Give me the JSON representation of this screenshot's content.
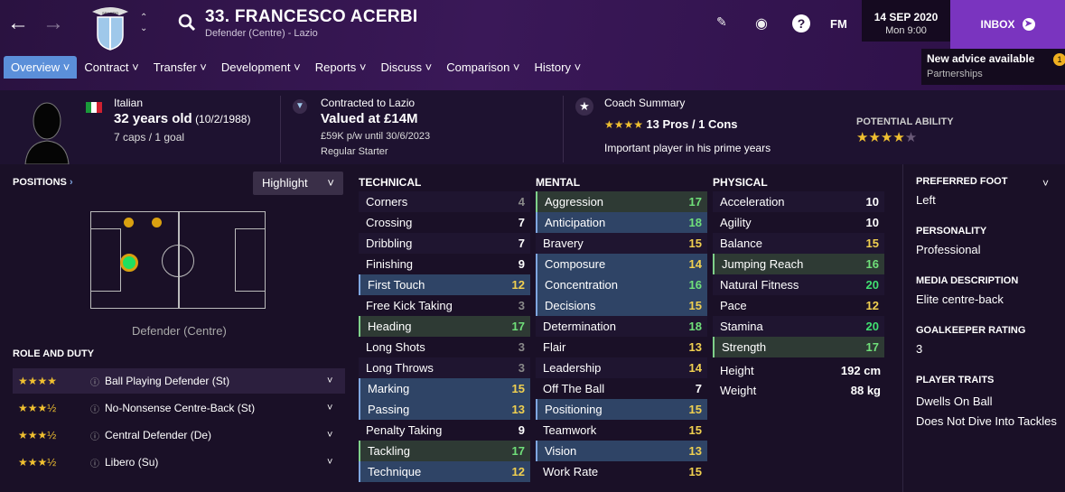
{
  "header": {
    "title": "33. FRANCESCO ACERBI",
    "subtitle": "Defender (Centre) - Lazio",
    "fm_label": "FM",
    "date": "14 SEP 2020",
    "time": "Mon 9:00",
    "inbox_label": "INBOX",
    "advice_title": "New advice available",
    "advice_sub": "Partnerships",
    "advice_count": "1",
    "crest_text": "SS LAZIO"
  },
  "menu": [
    "Overview",
    "Contract",
    "Transfer",
    "Development",
    "Reports",
    "Discuss",
    "Comparison",
    "History"
  ],
  "summary": {
    "nationality": "Italian",
    "age": "32 years old",
    "dob": "(10/2/1988)",
    "caps": "7 caps / 1 goal",
    "contract_label": "Contracted to Lazio",
    "value": "Valued at £14M",
    "wage": "£59K p/w until 30/6/2023",
    "status": "Regular Starter",
    "coach_label": "Coach Summary",
    "coach_summary": "13 Pros / 1 Cons",
    "coach_note": "Important player in his prime years",
    "coach_stars": "★★★★",
    "potential_label": "POTENTIAL ABILITY",
    "potential_stars": "★★★★",
    "potential_empty": "★"
  },
  "positions": {
    "heading": "POSITIONS",
    "highlight": "Highlight",
    "position_label": "Defender (Centre)"
  },
  "role_duty": {
    "heading": "ROLE AND DUTY",
    "roles": [
      {
        "name": "Ball Playing Defender (St)",
        "stars": "★★★★"
      },
      {
        "name": "No-Nonsense Centre-Back (St)",
        "stars": "★★★½"
      },
      {
        "name": "Central Defender (De)",
        "stars": "★★★½"
      },
      {
        "name": "Libero (Su)",
        "stars": "★★★½"
      }
    ]
  },
  "technical": {
    "heading": "TECHNICAL",
    "attrs": [
      {
        "name": "Corners",
        "value": "4"
      },
      {
        "name": "Crossing",
        "value": "7"
      },
      {
        "name": "Dribbling",
        "value": "7"
      },
      {
        "name": "Finishing",
        "value": "9"
      },
      {
        "name": "First Touch",
        "value": "12"
      },
      {
        "name": "Free Kick Taking",
        "value": "3"
      },
      {
        "name": "Heading",
        "value": "17"
      },
      {
        "name": "Long Shots",
        "value": "3"
      },
      {
        "name": "Long Throws",
        "value": "3"
      },
      {
        "name": "Marking",
        "value": "15"
      },
      {
        "name": "Passing",
        "value": "13"
      },
      {
        "name": "Penalty Taking",
        "value": "9"
      },
      {
        "name": "Tackling",
        "value": "17"
      },
      {
        "name": "Technique",
        "value": "12"
      }
    ]
  },
  "mental": {
    "heading": "MENTAL",
    "attrs": [
      {
        "name": "Aggression",
        "value": "17"
      },
      {
        "name": "Anticipation",
        "value": "18"
      },
      {
        "name": "Bravery",
        "value": "15"
      },
      {
        "name": "Composure",
        "value": "14"
      },
      {
        "name": "Concentration",
        "value": "16"
      },
      {
        "name": "Decisions",
        "value": "15"
      },
      {
        "name": "Determination",
        "value": "18"
      },
      {
        "name": "Flair",
        "value": "13"
      },
      {
        "name": "Leadership",
        "value": "14"
      },
      {
        "name": "Off The Ball",
        "value": "7"
      },
      {
        "name": "Positioning",
        "value": "15"
      },
      {
        "name": "Teamwork",
        "value": "15"
      },
      {
        "name": "Vision",
        "value": "13"
      },
      {
        "name": "Work Rate",
        "value": "15"
      }
    ]
  },
  "physical": {
    "heading": "PHYSICAL",
    "attrs": [
      {
        "name": "Acceleration",
        "value": "10"
      },
      {
        "name": "Agility",
        "value": "10"
      },
      {
        "name": "Balance",
        "value": "15"
      },
      {
        "name": "Jumping Reach",
        "value": "16"
      },
      {
        "name": "Natural Fitness",
        "value": "20"
      },
      {
        "name": "Pace",
        "value": "12"
      },
      {
        "name": "Stamina",
        "value": "20"
      },
      {
        "name": "Strength",
        "value": "17"
      }
    ],
    "height_label": "Height",
    "height": "192 cm",
    "weight_label": "Weight",
    "weight": "88 kg"
  },
  "right": {
    "foot_h": "PREFERRED FOOT",
    "foot": "Left",
    "pers_h": "PERSONALITY",
    "pers": "Professional",
    "media_h": "MEDIA DESCRIPTION",
    "media": "Elite centre-back",
    "gk_h": "GOALKEEPER RATING",
    "gk": "3",
    "traits_h": "PLAYER TRAITS",
    "trait1": "Dwells On Ball",
    "trait2": "Does Not Dive Into Tackles"
  },
  "colors": {
    "accent": "#7a34bf",
    "tab": "#5b8fd9",
    "star": "#f0c030",
    "green_dot": "#20e060",
    "gold_dot": "#d9a010"
  }
}
